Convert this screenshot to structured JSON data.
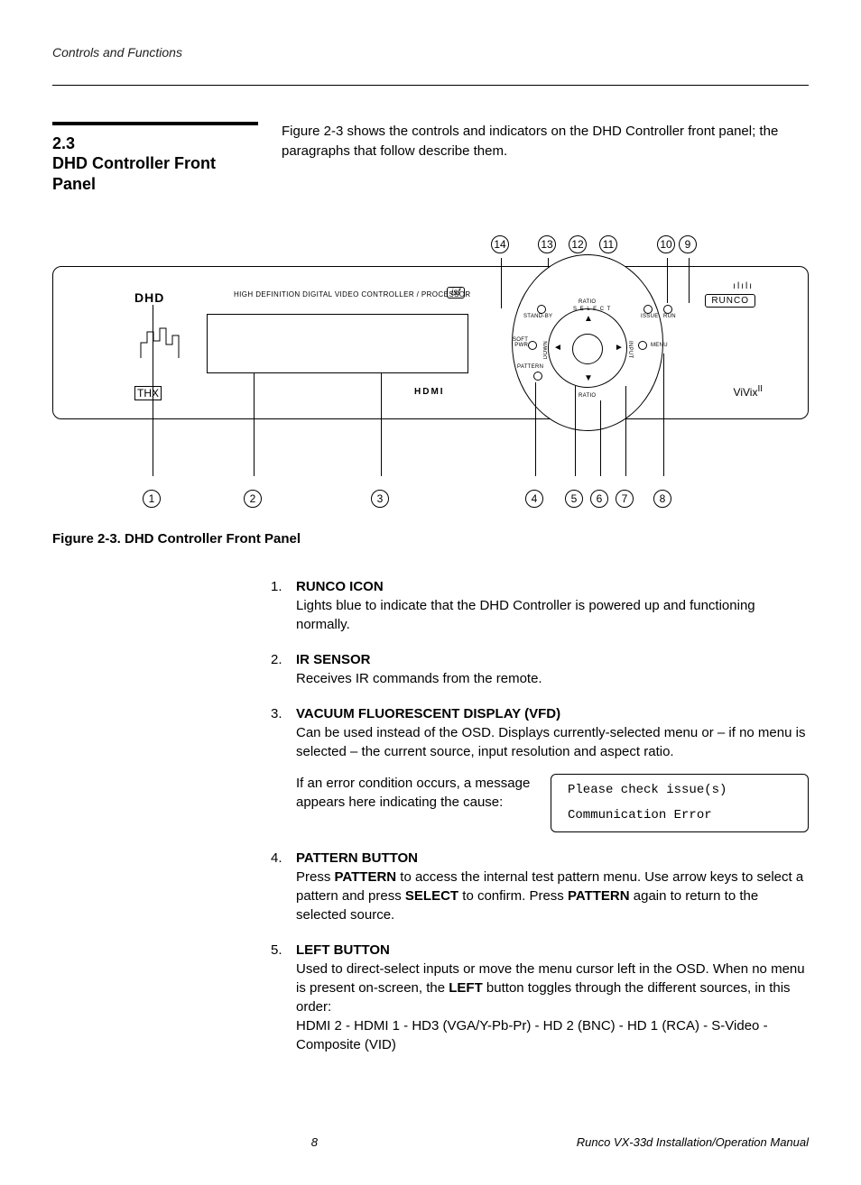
{
  "header": {
    "running": "Controls and Functions"
  },
  "section": {
    "number": "2.3",
    "title": "DHD Controller Front Panel",
    "lead": "Figure 2-3 shows the controls and indicators on the DHD Controller front panel; the paragraphs that follow describe them."
  },
  "figure": {
    "caption": "Figure 2-3. DHD Controller Front Panel",
    "top_callouts": [
      "14",
      "13",
      "12",
      "11",
      "10",
      "9"
    ],
    "bottom_callouts": [
      "1",
      "2",
      "3",
      "4",
      "5",
      "6",
      "7",
      "8"
    ],
    "panel_labels": {
      "long": "HIGH DEFINITION DIGITAL VIDEO CONTROLLER / PROCESSOR",
      "isf": "isf",
      "hdmi": "HDMI",
      "thx": "THX",
      "hd": "DHD",
      "runco": "RUNCO",
      "vivix": "ViVix",
      "vivix_sup": "II",
      "dial": {
        "ratio": "RATIO",
        "select": "S E L E C T",
        "standby": "STAND-BY",
        "softpwr": "SOFT\nPWR",
        "pattern": "PATTERN",
        "menu": "MENU",
        "issue": "ISSUE",
        "run": "RUN",
        "down": "DOWN",
        "input": "INPUT"
      }
    }
  },
  "items": [
    {
      "n": "1.",
      "term": "RUNCO ICON",
      "body_parts": [
        "Lights blue to indicate that the DHD Controller is powered up and functioning normally."
      ]
    },
    {
      "n": "2.",
      "term": "IR SENSOR",
      "body_parts": [
        "Receives IR commands from the remote."
      ]
    },
    {
      "n": "3.",
      "term": "VACUUM FLUORESCENT DISPLAY (VFD)",
      "body_parts": [
        "Can be used instead of the OSD. Displays currently-selected menu or – if no menu is selected – the current source, input resolution and aspect ratio.",
        "If an error condition occurs, a message appears here indicating the cause:"
      ],
      "vfd": {
        "line1": "Please check issue(s)",
        "line2": "Communication Error"
      }
    },
    {
      "n": "4.",
      "term": "PATTERN BUTTON",
      "body_html": "Press <b>PATTERN</b> to access the internal test pattern menu. Use arrow keys to select a pattern and press <b>SELECT</b> to confirm. Press <b>PATTERN</b> again to return to the selected source."
    },
    {
      "n": "5.",
      "term": "LEFT BUTTON",
      "body_html": "Used to direct-select inputs or move the menu cursor left in the OSD. When no menu is present on-screen, the <b>LEFT</b> button toggles through the different sources, in this order:<br>HDMI 2 - HDMI 1 - HD3 (VGA/Y-Pb-Pr) - HD 2 (BNC) - HD 1 (RCA) - S-Video - Composite (VID)"
    }
  ],
  "footer": {
    "page": "8",
    "doc": "Runco VX-33d Installation/Operation Manual"
  }
}
